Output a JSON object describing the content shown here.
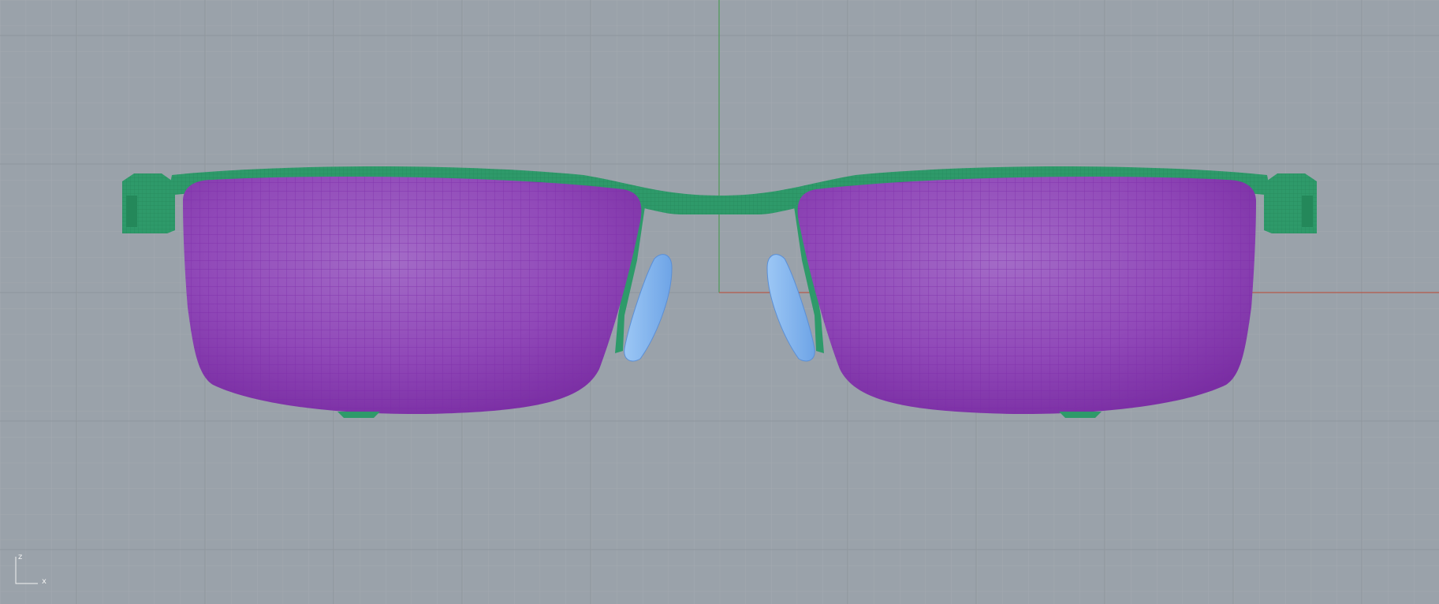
{
  "viewport": {
    "background_color": "#9aa2aa",
    "grid_minor_color": "#a8aeb4",
    "grid_major_color": "#8e959c",
    "axis_x_color": "#b5584a",
    "axis_z_color": "#4a9a55"
  },
  "object": {
    "frame_color": "#2e9a6a",
    "lens_color": "#8f3fb6",
    "lens_mesh_color": "#7a2aa4",
    "nosepad_color": "#7fb4ee"
  },
  "axis_gizmo": {
    "z_label": "z",
    "x_label": "x",
    "icon": "axis-gizmo-icon"
  }
}
